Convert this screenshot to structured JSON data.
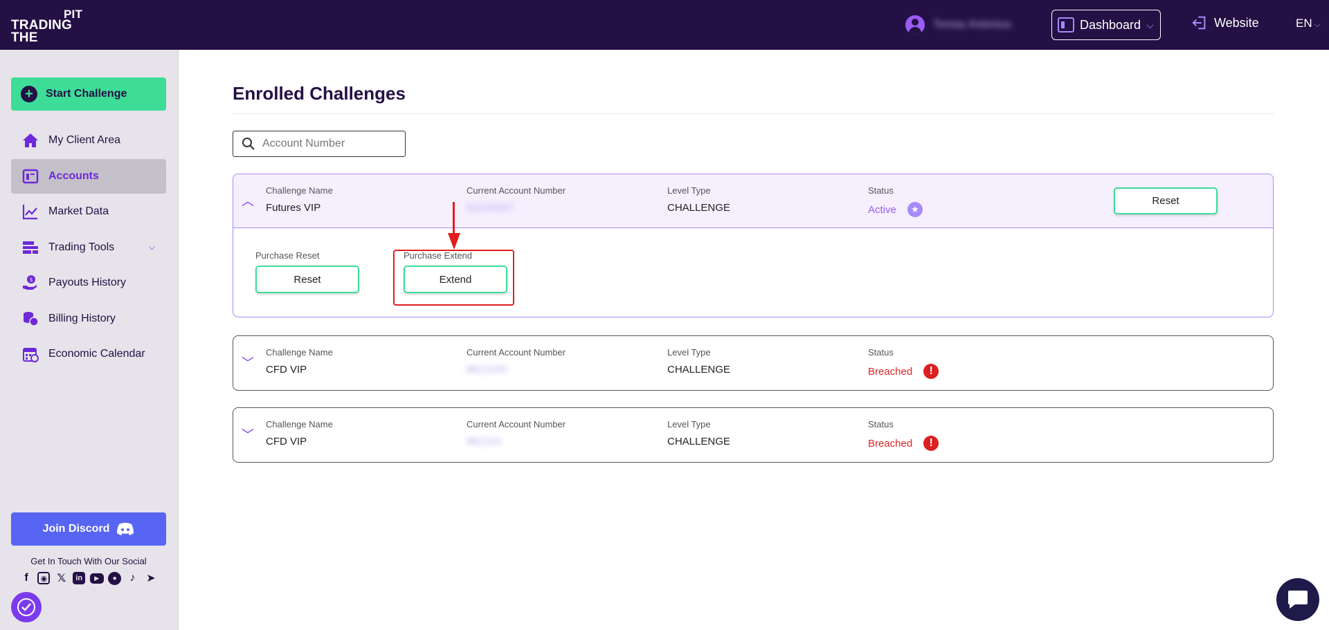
{
  "brand": {
    "line1": "PIT",
    "line2": "TRADING",
    "line3": "THE"
  },
  "header": {
    "user_name": "Tomas Antonius",
    "dashboard_label": "Dashboard",
    "website_label": "Website",
    "language": "EN"
  },
  "sidebar": {
    "start_challenge": "Start Challenge",
    "items": [
      {
        "label": "My Client Area",
        "icon": "home-icon"
      },
      {
        "label": "Accounts",
        "icon": "accounts-icon",
        "active": true
      },
      {
        "label": "Market Data",
        "icon": "chart-line-icon"
      },
      {
        "label": "Trading Tools",
        "icon": "tools-icon",
        "has_submenu": true
      },
      {
        "label": "Payouts History",
        "icon": "payout-icon"
      },
      {
        "label": "Billing History",
        "icon": "coins-icon"
      },
      {
        "label": "Economic Calendar",
        "icon": "calendar-icon"
      }
    ],
    "join_discord": "Join Discord",
    "social_title": "Get In Touch With Our Social",
    "socials": [
      "facebook-icon",
      "instagram-icon",
      "x-icon",
      "linkedin-icon",
      "youtube-icon",
      "reddit-icon",
      "tiktok-icon",
      "telegram-icon"
    ]
  },
  "main": {
    "title": "Enrolled Challenges",
    "search_placeholder": "Account Number",
    "columns": {
      "challenge_name": "Challenge Name",
      "account_number": "Current Account Number",
      "level_type": "Level Type",
      "status": "Status"
    },
    "challenges": [
      {
        "name": "Futures VIP",
        "account": "91234567",
        "level": "CHALLENGE",
        "status": "Active",
        "expanded": true,
        "action": "Reset"
      },
      {
        "name": "CFD VIP",
        "account": "8812345",
        "level": "CHALLENGE",
        "status": "Breached",
        "expanded": false
      },
      {
        "name": "CFD VIP",
        "account": "881234",
        "level": "CHALLENGE",
        "status": "Breached",
        "expanded": false
      }
    ],
    "purchase_reset_label": "Purchase Reset",
    "purchase_reset_button": "Reset",
    "purchase_extend_label": "Purchase Extend",
    "purchase_extend_button": "Extend"
  },
  "colors": {
    "topbar": "#241044",
    "accent_green": "#3ddc97",
    "accent_purple": "#7c3aed",
    "breached_red": "#dc2626",
    "discord": "#5865f2"
  }
}
